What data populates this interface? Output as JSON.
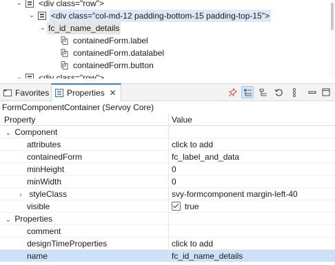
{
  "tree": {
    "nodes": [
      {
        "label": "<div class=\"row\">",
        "indent": 1,
        "expanded": true
      },
      {
        "label": "<div class=\"col-md-12 padding-bottom-15 padding-top-15\">",
        "indent": 2,
        "expanded": true,
        "selected": true
      },
      {
        "label": "fc_id_name_details",
        "indent": 3,
        "expanded": true,
        "highlighted": true
      },
      {
        "label": "containedForm.label",
        "indent": 4
      },
      {
        "label": "containedForm.datalabel",
        "indent": 4
      },
      {
        "label": "containedForm.button",
        "indent": 4
      },
      {
        "label": "<div class=\"row\">",
        "indent": 1,
        "partial": true
      }
    ]
  },
  "tabs": {
    "favorites": "Favorites",
    "properties": "Properties"
  },
  "toolbar": {
    "icons": [
      "pin-icon",
      "categories-icon",
      "advanced-icon",
      "restore-default-icon",
      "view-menu-icon",
      "minimize-icon",
      "maximize-icon"
    ]
  },
  "context_title": "FormComponentContainer (Servoy Core)",
  "table": {
    "header_property": "Property",
    "header_value": "Value",
    "rows": [
      {
        "type": "category",
        "name": "Component",
        "value": ""
      },
      {
        "type": "prop",
        "name": "attributes",
        "value": "click to add"
      },
      {
        "type": "prop",
        "name": "containedForm",
        "value": "fc_label_and_data"
      },
      {
        "type": "prop",
        "name": "minHeight",
        "value": "0"
      },
      {
        "type": "prop",
        "name": "minWidth",
        "value": "0"
      },
      {
        "type": "prop-collapsed",
        "name": "styleClass",
        "value": "svy-formcomponent margin-left-40"
      },
      {
        "type": "checkbox",
        "name": "visible",
        "value": "true"
      },
      {
        "type": "category",
        "name": "Properties",
        "value": ""
      },
      {
        "type": "prop",
        "name": "comment",
        "value": ""
      },
      {
        "type": "prop",
        "name": "designTimeProperties",
        "value": "click to add"
      },
      {
        "type": "prop-selected",
        "name": "name",
        "value": "fc_id_name_details"
      }
    ]
  }
}
